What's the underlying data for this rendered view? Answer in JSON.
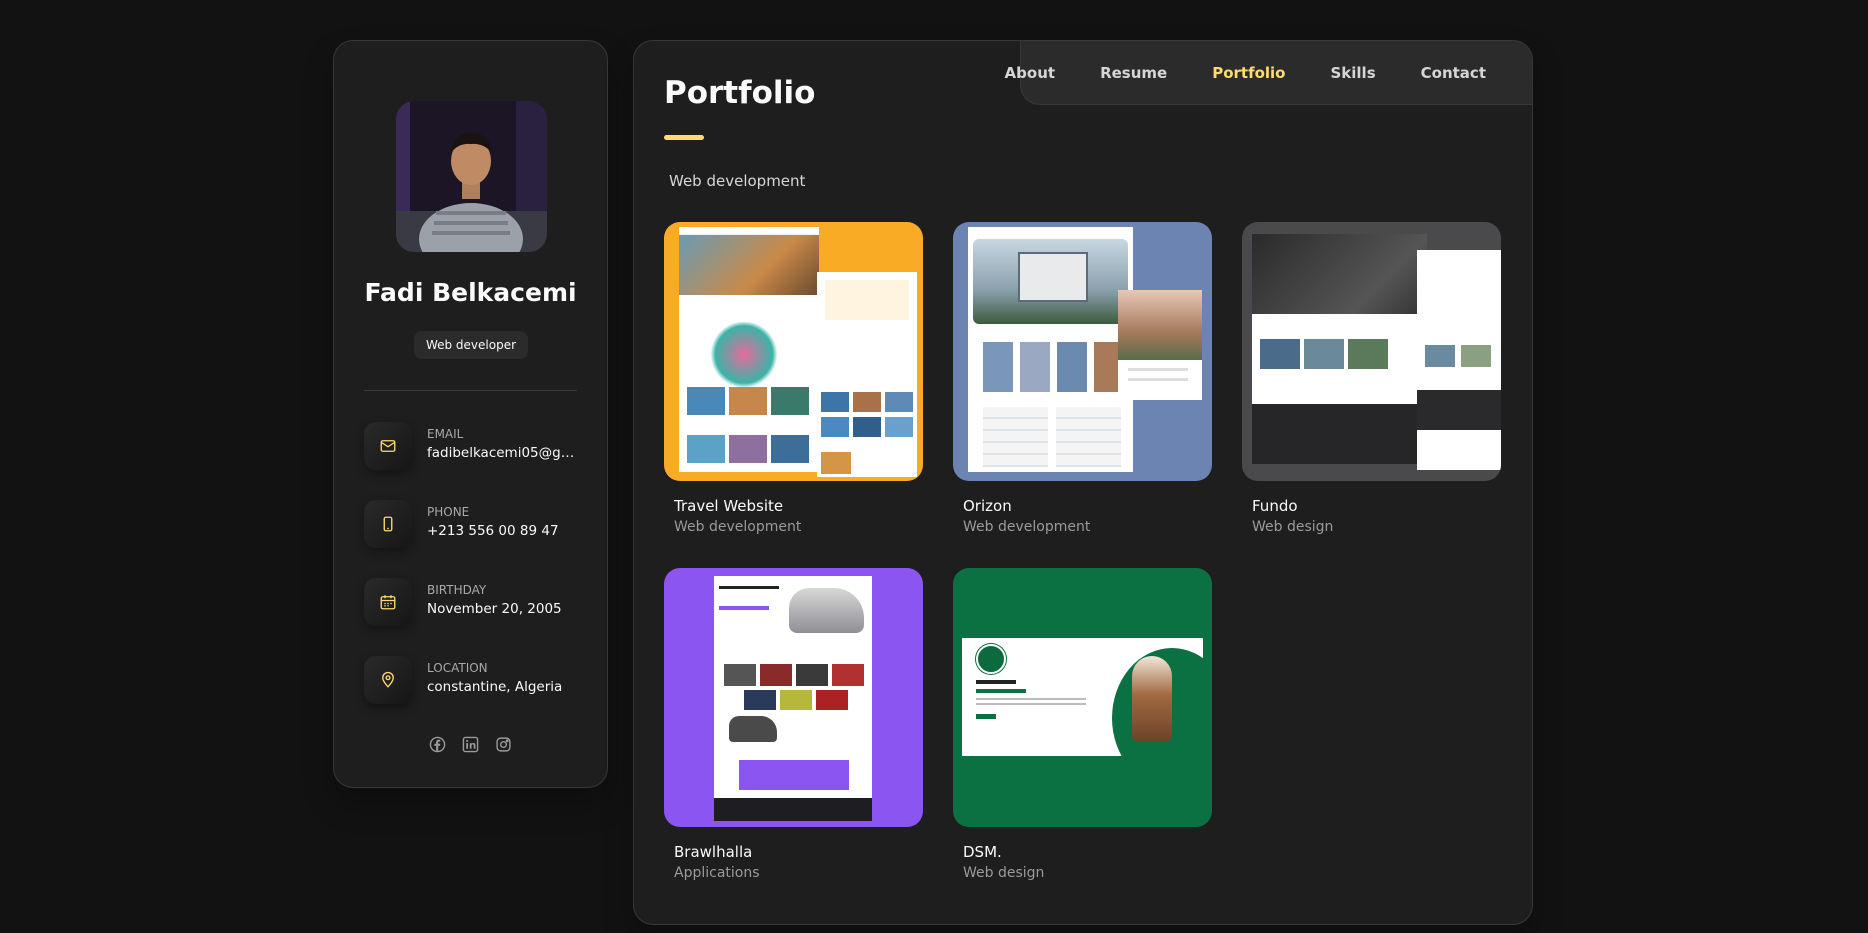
{
  "profile": {
    "name": "Fadi Belkacemi",
    "role": "Web developer"
  },
  "contacts": [
    {
      "label": "Email",
      "value": "fadibelkacemi05@gmail.com",
      "icon": "mail-icon"
    },
    {
      "label": "Phone",
      "value": "+213 556 00 89 47",
      "icon": "phone-icon"
    },
    {
      "label": "Birthday",
      "value": "November 20, 2005",
      "icon": "calendar-icon"
    },
    {
      "label": "Location",
      "value": "constantine, Algeria",
      "icon": "location-icon"
    }
  ],
  "social": [
    "facebook-icon",
    "linkedin-icon",
    "instagram-icon"
  ],
  "nav": {
    "items": [
      "About",
      "Resume",
      "Portfolio",
      "Skills",
      "Contact"
    ],
    "active": "Portfolio"
  },
  "page": {
    "title": "Portfolio",
    "filter": "Web development"
  },
  "projects": [
    {
      "title": "Travel Website",
      "category": "Web development",
      "bg": "#f9ab25"
    },
    {
      "title": "Orizon",
      "category": "Web development",
      "bg": "#6b84b1"
    },
    {
      "title": "Fundo",
      "category": "Web design",
      "bg": "#4a4a4c"
    },
    {
      "title": "Brawlhalla",
      "category": "Applications",
      "bg": "#8b55f2"
    },
    {
      "title": "DSM.",
      "category": "Web design",
      "bg": "#0b7142"
    }
  ],
  "colors": {
    "accent": "#ffdb70",
    "panel": "#1e1e1f",
    "page_bg": "#121212"
  }
}
